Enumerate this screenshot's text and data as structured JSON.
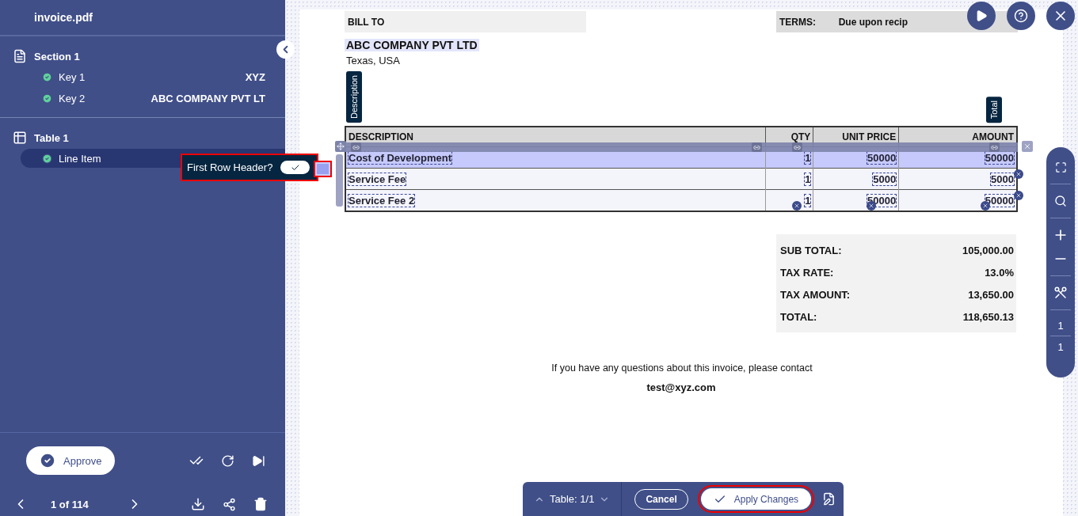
{
  "sidebar": {
    "file_name": "invoice.pdf",
    "groups": [
      {
        "kind": "section",
        "title": "Section 1",
        "items": [
          {
            "label": "Key 1",
            "value": "XYZ",
            "verified": true,
            "selected": false
          },
          {
            "label": "Key 2",
            "value": "ABC COMPANY PVT LT",
            "verified": true,
            "selected": false
          }
        ]
      },
      {
        "kind": "table",
        "title": "Table 1",
        "items": [
          {
            "label": "Line Item",
            "verified": true,
            "selected": true
          }
        ]
      }
    ],
    "approve_label": "Approve",
    "pager": "1 of 114"
  },
  "first_row_header": {
    "label": "First Row Header?",
    "on": true
  },
  "document": {
    "bill_to": "BILL TO",
    "terms_label": "TERMS:",
    "terms_value": "Due upon recip",
    "company": "ABC COMPANY PVT LTD",
    "address": "Texas, USA",
    "column_tags": [
      "Description",
      "Total"
    ],
    "columns": [
      "DESCRIPTION",
      "QTY",
      "UNIT PRICE",
      "AMOUNT"
    ],
    "rows": [
      {
        "cells": [
          "Cost of Development",
          "1",
          "50000",
          "50000"
        ],
        "selected": true
      },
      {
        "cells": [
          "Service Fee",
          "1",
          "5000",
          "5000"
        ],
        "selected": false
      },
      {
        "cells": [
          "Service Fee 2",
          "1",
          "50000",
          "50000"
        ],
        "selected": false
      }
    ],
    "totals": [
      {
        "label": "SUB TOTAL:",
        "value": "105,000.00"
      },
      {
        "label": "TAX RATE:",
        "value": "13.0%"
      },
      {
        "label": "TAX AMOUNT:",
        "value": "13,650.00"
      },
      {
        "label": "TOTAL:",
        "value": "118,650.13"
      }
    ],
    "note": "If you have any questions about this invoice, please contact",
    "email": "test@xyz.com"
  },
  "page_counter": [
    "1",
    "1"
  ],
  "table_toolbar": {
    "indicator": "Table: 1/1",
    "cancel": "Cancel",
    "apply": "Apply Changes"
  }
}
